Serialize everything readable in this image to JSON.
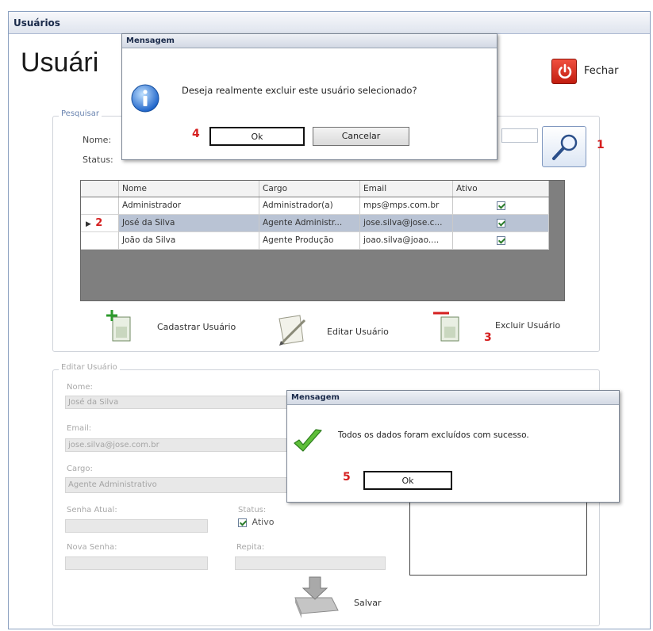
{
  "window": {
    "title": "Usuários"
  },
  "header": {
    "page_title": "Usuári",
    "close_label": "Fechar"
  },
  "search": {
    "legend": "Pesquisar",
    "name_label": "Nome:",
    "status_label": "Status:",
    "marker": "1"
  },
  "grid": {
    "columns": [
      "Nome",
      "Cargo",
      "Email",
      "Ativo"
    ],
    "rows": [
      {
        "name": "Administrador",
        "role": "Administrador(a)",
        "email": "mps@mps.com.br",
        "active": true,
        "marker": ""
      },
      {
        "name": "José da Silva",
        "role": "Agente Administr...",
        "email": "jose.silva@jose.c...",
        "active": true,
        "marker": "2"
      },
      {
        "name": "João da Silva",
        "role": "Agente Produção",
        "email": "joao.silva@joao....",
        "active": true,
        "marker": ""
      }
    ]
  },
  "actions": {
    "add_user": "Cadastrar Usuário",
    "edit_user": "Editar Usuário",
    "delete_user": "Excluir Usuário",
    "delete_marker": "3"
  },
  "edit": {
    "legend": "Editar Usuário",
    "name_label": "Nome:",
    "name_value": "José da Silva",
    "email_label": "Email:",
    "email_value": "jose.silva@jose.com.br",
    "role_label": "Cargo:",
    "role_value": "Agente Administrativo",
    "current_password_label": "Senha Atual:",
    "status_label": "Status:",
    "active_label": "Ativo",
    "new_password_label": "Nova Senha:",
    "repeat_label": "Repita:",
    "save_label": "Salvar"
  },
  "confirm_dialog": {
    "title": "Mensagem",
    "message": "Deseja realmente excluir este usuário selecionado?",
    "ok_label": "Ok",
    "cancel_label": "Cancelar",
    "marker": "4"
  },
  "success_dialog": {
    "title": "Mensagem",
    "message": "Todos os dados foram excluídos com sucesso.",
    "ok_label": "Ok",
    "marker": "5"
  },
  "colors": {
    "marker_red": "#d51f1f",
    "power_red": "#d7291a",
    "selected_row": "#b9c3d4"
  }
}
